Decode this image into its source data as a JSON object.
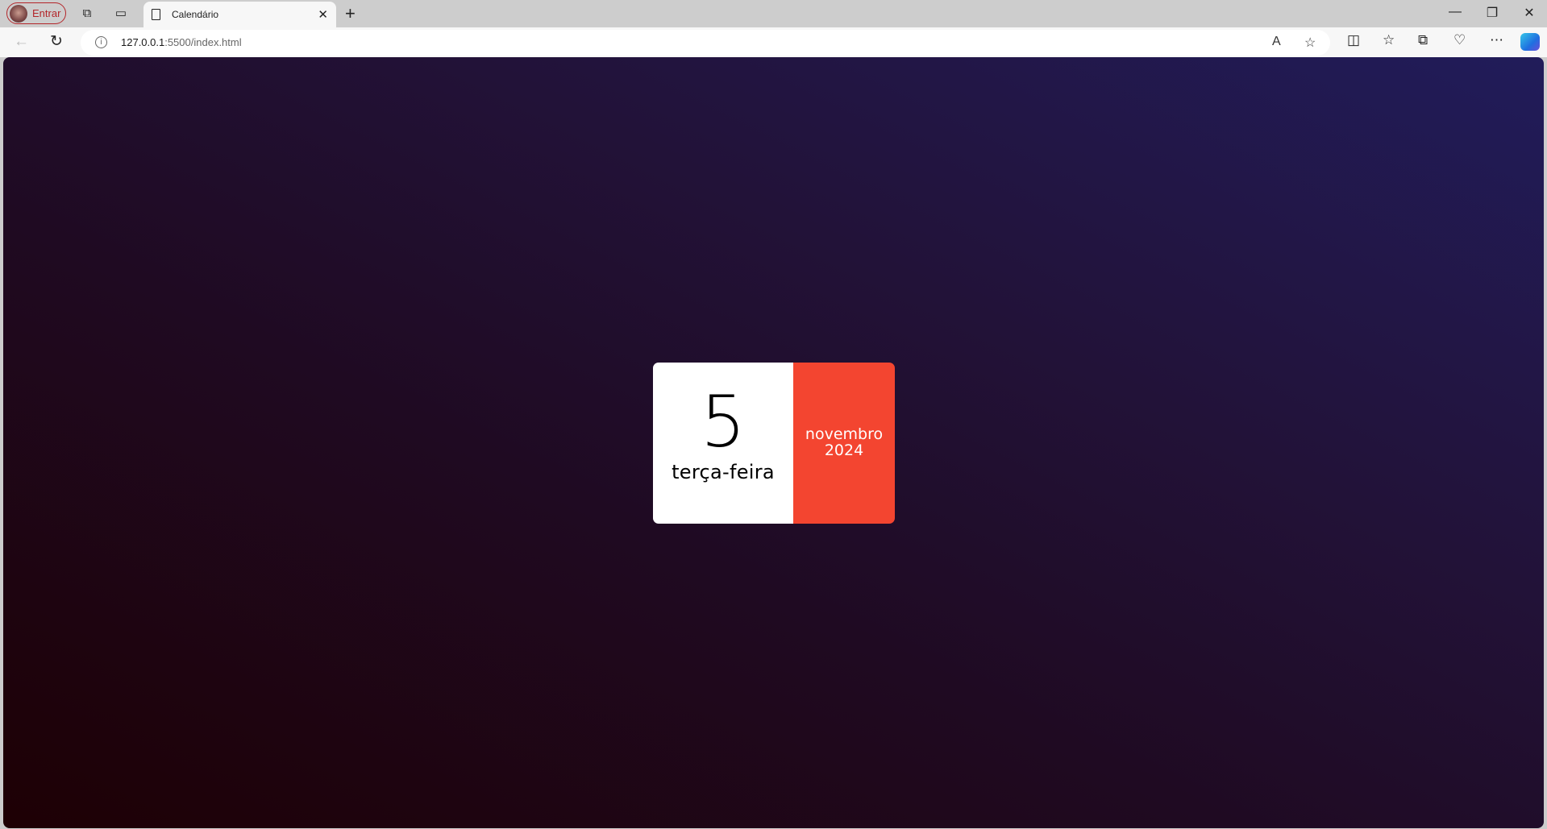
{
  "browser": {
    "profile_label": "Entrar",
    "tab_title": "Calendário",
    "url_host": "127.0.0.1",
    "url_rest": ":5500/index.html",
    "icons": [
      "workspaces-icon",
      "tab-actions-icon",
      "read-aloud-icon",
      "favorite-star-icon",
      "split-screen-icon",
      "favorites-icon",
      "collections-icon",
      "browser-essentials-icon",
      "more-icon",
      "copilot-icon"
    ]
  },
  "calendar": {
    "day": "5",
    "weekday": "terça-feira",
    "month": "novembro",
    "year": "2024",
    "colors": {
      "accent": "#f34530",
      "card": "#ffffff",
      "bg_start": "#1e0004",
      "bg_end": "#211c5a"
    }
  }
}
